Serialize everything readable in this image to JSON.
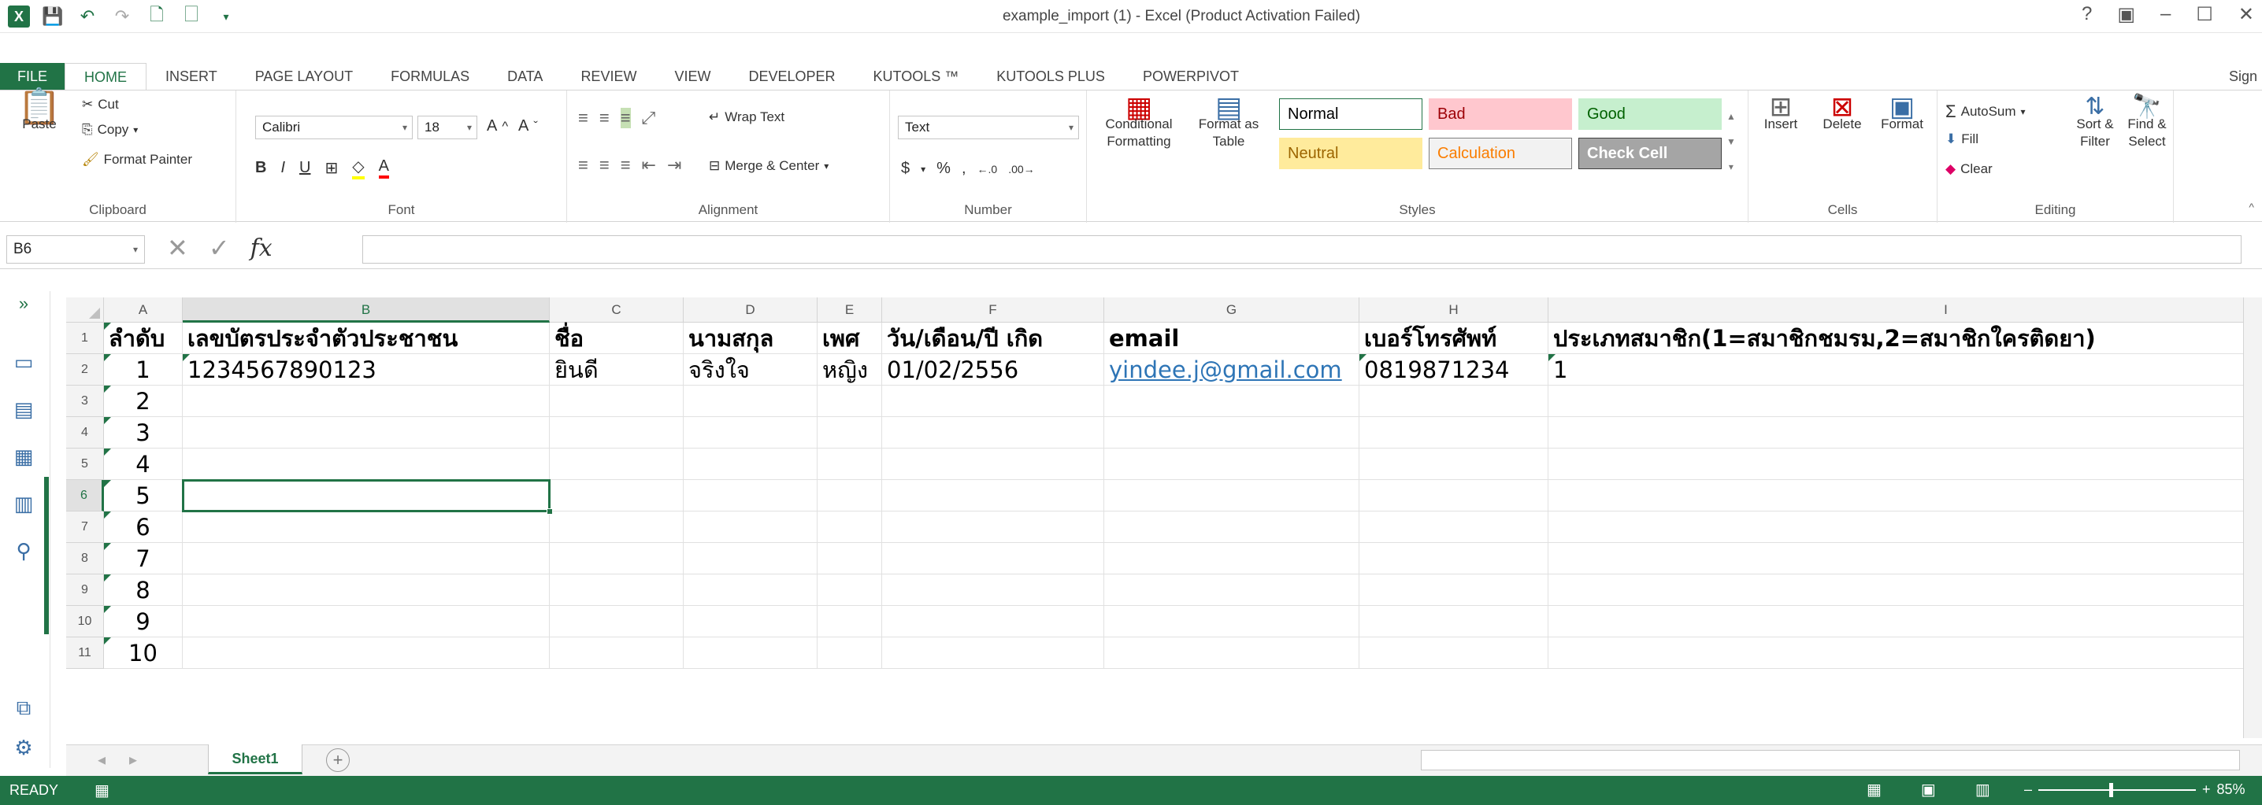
{
  "window": {
    "title": "example_import (1) - Excel (Product Activation Failed)",
    "controls": [
      "?",
      "▣",
      "–",
      "☐",
      "✕"
    ]
  },
  "tabs": [
    "FILE",
    "HOME",
    "INSERT",
    "PAGE LAYOUT",
    "FORMULAS",
    "DATA",
    "REVIEW",
    "VIEW",
    "DEVELOPER",
    "KUTOOLS ™",
    "KUTOOLS PLUS",
    "POWERPIVOT"
  ],
  "active_tab": "HOME",
  "sign_in": "Sign",
  "ribbon": {
    "clipboard": {
      "label": "Clipboard",
      "paste": "Paste",
      "cut": "Cut",
      "copy": "Copy",
      "format_painter": "Format Painter"
    },
    "font": {
      "label": "Font",
      "name": "Calibri",
      "size": "18"
    },
    "alignment": {
      "label": "Alignment",
      "wrap_text": "Wrap Text",
      "merge_center": "Merge & Center"
    },
    "number": {
      "label": "Number",
      "format": "Text",
      "currency": "$",
      "percent": "%",
      "comma": ","
    },
    "styles": {
      "label": "Styles",
      "conditional": "Conditional Formatting",
      "format_table": "Format as Table",
      "cells": [
        {
          "name": "Normal",
          "bg": "#ffffff",
          "fg": "#000000",
          "border": "#217346"
        },
        {
          "name": "Bad",
          "bg": "#ffc7ce",
          "fg": "#9c0006",
          "border": "#ffc7ce"
        },
        {
          "name": "Good",
          "bg": "#c6efce",
          "fg": "#006100",
          "border": "#c6efce"
        },
        {
          "name": "Neutral",
          "bg": "#ffeb9c",
          "fg": "#9c6500",
          "border": "#ffeb9c"
        },
        {
          "name": "Calculation",
          "bg": "#f2f2f2",
          "fg": "#fa7d00",
          "border": "#7f7f7f"
        },
        {
          "name": "Check Cell",
          "bg": "#a5a5a5",
          "fg": "#ffffff",
          "border": "#3f3f3f"
        }
      ]
    },
    "cells": {
      "label": "Cells",
      "insert": "Insert",
      "delete": "Delete",
      "format": "Format"
    },
    "editing": {
      "label": "Editing",
      "autosum": "AutoSum",
      "fill": "Fill",
      "clear": "Clear",
      "sort_filter": "Sort & Filter",
      "find_select": "Find & Select"
    }
  },
  "formula_bar": {
    "name_box": "B6",
    "fx": "fx",
    "value": ""
  },
  "columns": [
    "A",
    "B",
    "C",
    "D",
    "E",
    "F",
    "G",
    "H",
    "I"
  ],
  "selected_column": "B",
  "selected_row": "6",
  "rows": [
    {
      "num": "1",
      "cells": [
        "ลำดับ",
        "เลขบัตรประจำตัวประชาชน",
        "ชื่อ",
        "นามสกุล",
        "เพศ",
        "วัน/เดือน/ปี เกิด",
        "email",
        "เบอร์โทรศัพท์",
        "ประเภทสมาชิก(1=สมาชิกชมรม,2=สมาชิกใครติดยา)"
      ]
    },
    {
      "num": "2",
      "cells": [
        "1",
        "1234567890123",
        "ยินดี",
        "จริงใจ",
        "หญิง",
        "01/02/2556",
        "yindee.j@gmail.com",
        "0819871234",
        "1"
      ]
    },
    {
      "num": "3",
      "cells": [
        "2",
        "",
        "",
        "",
        "",
        "",
        "",
        "",
        ""
      ]
    },
    {
      "num": "4",
      "cells": [
        "3",
        "",
        "",
        "",
        "",
        "",
        "",
        "",
        ""
      ]
    },
    {
      "num": "5",
      "cells": [
        "4",
        "",
        "",
        "",
        "",
        "",
        "",
        "",
        ""
      ]
    },
    {
      "num": "6",
      "cells": [
        "5",
        "",
        "",
        "",
        "",
        "",
        "",
        "",
        ""
      ]
    },
    {
      "num": "7",
      "cells": [
        "6",
        "",
        "",
        "",
        "",
        "",
        "",
        "",
        ""
      ]
    },
    {
      "num": "8",
      "cells": [
        "7",
        "",
        "",
        "",
        "",
        "",
        "",
        "",
        ""
      ]
    },
    {
      "num": "9",
      "cells": [
        "8",
        "",
        "",
        "",
        "",
        "",
        "",
        "",
        ""
      ]
    },
    {
      "num": "10",
      "cells": [
        "9",
        "",
        "",
        "",
        "",
        "",
        "",
        "",
        ""
      ]
    },
    {
      "num": "11",
      "cells": [
        "10",
        "",
        "",
        "",
        "",
        "",
        "",
        "",
        ""
      ]
    }
  ],
  "sheet_tab": "Sheet1",
  "status": {
    "ready": "READY",
    "zoom": "85%"
  },
  "colors": {
    "accent": "#217346",
    "link": "#2e75b6"
  }
}
